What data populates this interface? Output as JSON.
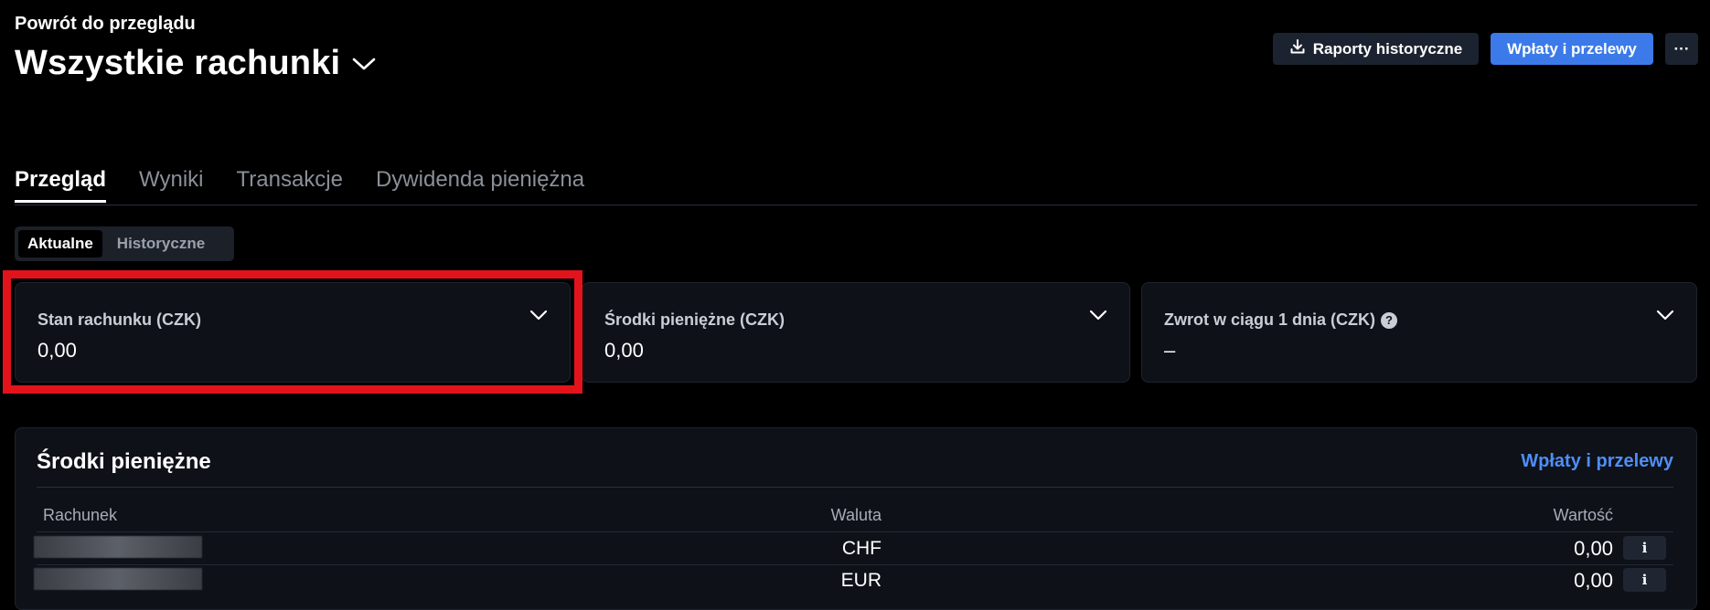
{
  "header": {
    "back_label": "Powrót do przeglądu",
    "title": "Wszystkie rachunki",
    "reports_label": "Raporty historyczne",
    "transfers_label": "Wpłaty i przelewy",
    "more_label": "···"
  },
  "tabs": [
    {
      "label": "Przegląd",
      "active": true
    },
    {
      "label": "Wyniki",
      "active": false
    },
    {
      "label": "Transakcje",
      "active": false
    },
    {
      "label": "Dywidenda pieniężna",
      "active": false
    }
  ],
  "segment": {
    "current": "Aktualne",
    "historical": "Historyczne",
    "selected": "Aktualne"
  },
  "cards": {
    "balance": {
      "label": "Stan rachunku (CZK)",
      "value": "0,00"
    },
    "cash": {
      "label": "Środki pieniężne (CZK)",
      "value": "0,00"
    },
    "return": {
      "label": "Zwrot w ciągu 1 dnia (CZK)",
      "value": "–",
      "help_icon": "?"
    }
  },
  "cash_panel": {
    "title": "Środki pieniężne",
    "link": "Wpłaty i przelewy",
    "columns": {
      "account": "Rachunek",
      "currency": "Waluta",
      "value": "Wartość"
    },
    "rows": [
      {
        "currency": "CHF",
        "value": "0,00",
        "info": "i"
      },
      {
        "currency": "EUR",
        "value": "0,00",
        "info": "i"
      }
    ]
  },
  "colors": {
    "background": "#000000",
    "card": "#0e1118",
    "accent": "#3b7ae8",
    "link": "#4f8ef7",
    "highlight": "#e3131b"
  }
}
